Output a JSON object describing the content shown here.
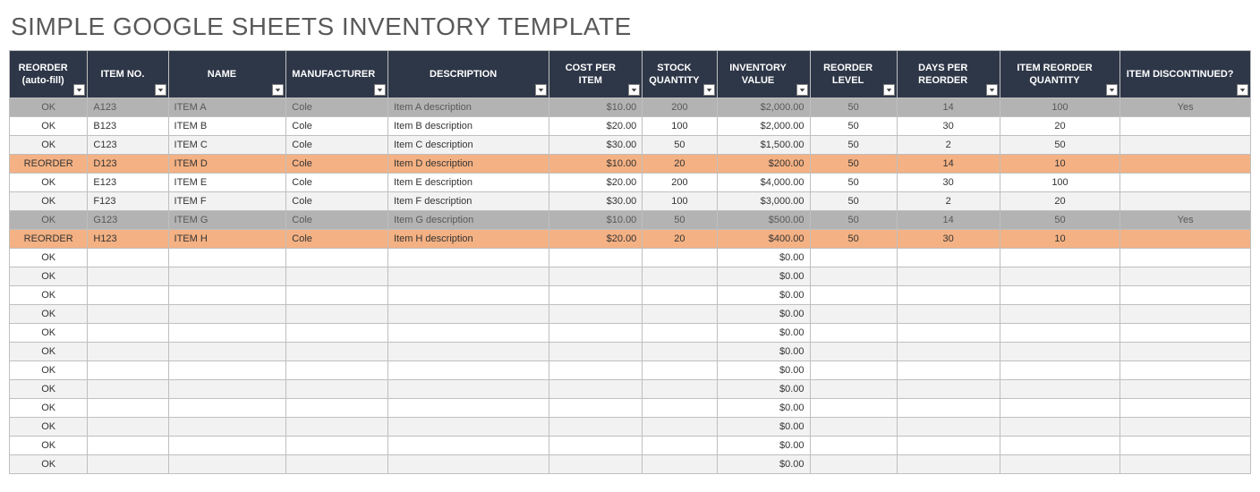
{
  "title": "SIMPLE GOOGLE SHEETS INVENTORY TEMPLATE",
  "columns": [
    {
      "key": "status",
      "label": "REORDER (auto-fill)",
      "align": "center"
    },
    {
      "key": "item_no",
      "label": "ITEM NO.",
      "align": "left"
    },
    {
      "key": "name",
      "label": "NAME",
      "align": "left"
    },
    {
      "key": "manufacturer",
      "label": "MANUFACTURER",
      "align": "left"
    },
    {
      "key": "description",
      "label": "DESCRIPTION",
      "align": "left"
    },
    {
      "key": "cost",
      "label": "COST PER ITEM",
      "align": "right"
    },
    {
      "key": "stock",
      "label": "STOCK QUANTITY",
      "align": "center"
    },
    {
      "key": "value",
      "label": "INVENTORY VALUE",
      "align": "right"
    },
    {
      "key": "reorder_level",
      "label": "REORDER LEVEL",
      "align": "center"
    },
    {
      "key": "days",
      "label": "DAYS PER REORDER",
      "align": "center"
    },
    {
      "key": "reorder_qty",
      "label": "ITEM REORDER QUANTITY",
      "align": "center"
    },
    {
      "key": "discontinued",
      "label": "ITEM DISCONTINUED?",
      "align": "center"
    }
  ],
  "rows": [
    {
      "status": "OK",
      "item_no": "A123",
      "name": "ITEM A",
      "manufacturer": "Cole",
      "description": "Item A description",
      "cost": "$10.00",
      "stock": "200",
      "value": "$2,000.00",
      "reorder_level": "50",
      "days": "14",
      "reorder_qty": "100",
      "discontinued": "Yes",
      "style": "disc"
    },
    {
      "status": "OK",
      "item_no": "B123",
      "name": "ITEM B",
      "manufacturer": "Cole",
      "description": "Item B description",
      "cost": "$20.00",
      "stock": "100",
      "value": "$2,000.00",
      "reorder_level": "50",
      "days": "30",
      "reorder_qty": "20",
      "discontinued": "",
      "style": ""
    },
    {
      "status": "OK",
      "item_no": "C123",
      "name": "ITEM C",
      "manufacturer": "Cole",
      "description": "Item C description",
      "cost": "$30.00",
      "stock": "50",
      "value": "$1,500.00",
      "reorder_level": "50",
      "days": "2",
      "reorder_qty": "50",
      "discontinued": "",
      "style": "alt"
    },
    {
      "status": "REORDER",
      "item_no": "D123",
      "name": "ITEM D",
      "manufacturer": "Cole",
      "description": "Item D description",
      "cost": "$10.00",
      "stock": "20",
      "value": "$200.00",
      "reorder_level": "50",
      "days": "14",
      "reorder_qty": "10",
      "discontinued": "",
      "style": "reorder"
    },
    {
      "status": "OK",
      "item_no": "E123",
      "name": "ITEM E",
      "manufacturer": "Cole",
      "description": "Item E description",
      "cost": "$20.00",
      "stock": "200",
      "value": "$4,000.00",
      "reorder_level": "50",
      "days": "30",
      "reorder_qty": "100",
      "discontinued": "",
      "style": ""
    },
    {
      "status": "OK",
      "item_no": "F123",
      "name": "ITEM F",
      "manufacturer": "Cole",
      "description": "Item F description",
      "cost": "$30.00",
      "stock": "100",
      "value": "$3,000.00",
      "reorder_level": "50",
      "days": "2",
      "reorder_qty": "20",
      "discontinued": "",
      "style": "alt"
    },
    {
      "status": "OK",
      "item_no": "G123",
      "name": "ITEM G",
      "manufacturer": "Cole",
      "description": "Item G description",
      "cost": "$10.00",
      "stock": "50",
      "value": "$500.00",
      "reorder_level": "50",
      "days": "14",
      "reorder_qty": "50",
      "discontinued": "Yes",
      "style": "disc"
    },
    {
      "status": "REORDER",
      "item_no": "H123",
      "name": "ITEM H",
      "manufacturer": "Cole",
      "description": "Item H description",
      "cost": "$20.00",
      "stock": "20",
      "value": "$400.00",
      "reorder_level": "50",
      "days": "30",
      "reorder_qty": "10",
      "discontinued": "",
      "style": "reorder"
    },
    {
      "status": "OK",
      "item_no": "",
      "name": "",
      "manufacturer": "",
      "description": "",
      "cost": "",
      "stock": "",
      "value": "$0.00",
      "reorder_level": "",
      "days": "",
      "reorder_qty": "",
      "discontinued": "",
      "style": ""
    },
    {
      "status": "OK",
      "item_no": "",
      "name": "",
      "manufacturer": "",
      "description": "",
      "cost": "",
      "stock": "",
      "value": "$0.00",
      "reorder_level": "",
      "days": "",
      "reorder_qty": "",
      "discontinued": "",
      "style": "alt"
    },
    {
      "status": "OK",
      "item_no": "",
      "name": "",
      "manufacturer": "",
      "description": "",
      "cost": "",
      "stock": "",
      "value": "$0.00",
      "reorder_level": "",
      "days": "",
      "reorder_qty": "",
      "discontinued": "",
      "style": ""
    },
    {
      "status": "OK",
      "item_no": "",
      "name": "",
      "manufacturer": "",
      "description": "",
      "cost": "",
      "stock": "",
      "value": "$0.00",
      "reorder_level": "",
      "days": "",
      "reorder_qty": "",
      "discontinued": "",
      "style": "alt"
    },
    {
      "status": "OK",
      "item_no": "",
      "name": "",
      "manufacturer": "",
      "description": "",
      "cost": "",
      "stock": "",
      "value": "$0.00",
      "reorder_level": "",
      "days": "",
      "reorder_qty": "",
      "discontinued": "",
      "style": ""
    },
    {
      "status": "OK",
      "item_no": "",
      "name": "",
      "manufacturer": "",
      "description": "",
      "cost": "",
      "stock": "",
      "value": "$0.00",
      "reorder_level": "",
      "days": "",
      "reorder_qty": "",
      "discontinued": "",
      "style": "alt"
    },
    {
      "status": "OK",
      "item_no": "",
      "name": "",
      "manufacturer": "",
      "description": "",
      "cost": "",
      "stock": "",
      "value": "$0.00",
      "reorder_level": "",
      "days": "",
      "reorder_qty": "",
      "discontinued": "",
      "style": ""
    },
    {
      "status": "OK",
      "item_no": "",
      "name": "",
      "manufacturer": "",
      "description": "",
      "cost": "",
      "stock": "",
      "value": "$0.00",
      "reorder_level": "",
      "days": "",
      "reorder_qty": "",
      "discontinued": "",
      "style": "alt"
    },
    {
      "status": "OK",
      "item_no": "",
      "name": "",
      "manufacturer": "",
      "description": "",
      "cost": "",
      "stock": "",
      "value": "$0.00",
      "reorder_level": "",
      "days": "",
      "reorder_qty": "",
      "discontinued": "",
      "style": ""
    },
    {
      "status": "OK",
      "item_no": "",
      "name": "",
      "manufacturer": "",
      "description": "",
      "cost": "",
      "stock": "",
      "value": "$0.00",
      "reorder_level": "",
      "days": "",
      "reorder_qty": "",
      "discontinued": "",
      "style": "alt"
    },
    {
      "status": "OK",
      "item_no": "",
      "name": "",
      "manufacturer": "",
      "description": "",
      "cost": "",
      "stock": "",
      "value": "$0.00",
      "reorder_level": "",
      "days": "",
      "reorder_qty": "",
      "discontinued": "",
      "style": ""
    },
    {
      "status": "OK",
      "item_no": "",
      "name": "",
      "manufacturer": "",
      "description": "",
      "cost": "",
      "stock": "",
      "value": "$0.00",
      "reorder_level": "",
      "days": "",
      "reorder_qty": "",
      "discontinued": "",
      "style": "alt"
    }
  ]
}
